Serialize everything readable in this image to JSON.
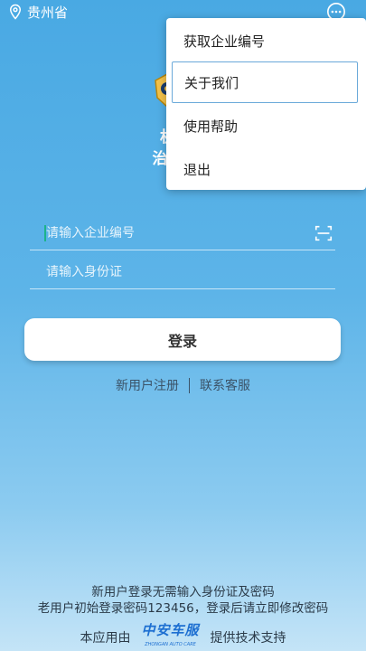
{
  "status_bar": {
    "location": "贵州省",
    "location_icon": "location-pin-icon",
    "more_icon": "more-options-icon"
  },
  "header": {
    "title_line1": "机动车",
    "title_line2": "治安管理"
  },
  "form": {
    "company_placeholder": "请输入企业编号",
    "company_value": "",
    "idcard_placeholder": "请输入身份证",
    "idcard_value": "",
    "scan_icon": "scan-icon",
    "login_label": "登录"
  },
  "links": {
    "register": "新用户注册",
    "support": "联系客服"
  },
  "footer": {
    "note_line1": "新用户登录无需输入身份证及密码",
    "note_line2": "老用户初始登录密码123456，登录后请立即修改密码",
    "powered_prefix": "本应用由",
    "brand_name": "中安车服",
    "brand_sub": "ZHONGAN AUTO CARE",
    "powered_suffix": "提供技术支持"
  },
  "menu": {
    "items": [
      {
        "label": "获取企业编号"
      },
      {
        "label": "关于我们"
      },
      {
        "label": "使用帮助"
      },
      {
        "label": "退出"
      }
    ]
  },
  "colors": {
    "background_top": "#49a9e3",
    "background_bottom": "#c4e4f7",
    "brand_blue": "#1d6fd1",
    "focus_outline": "#6aa9d9"
  }
}
